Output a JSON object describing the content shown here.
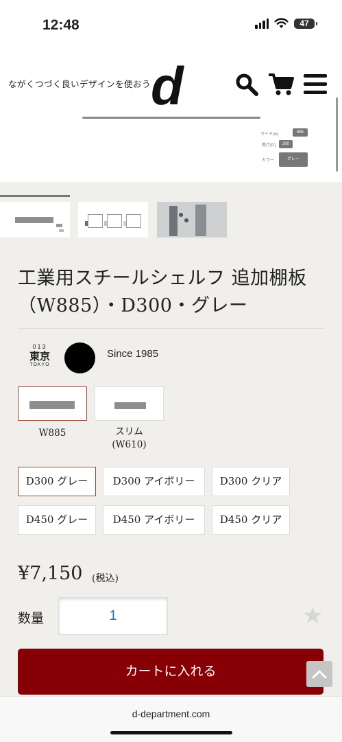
{
  "status_bar": {
    "time": "12:48",
    "battery": "47"
  },
  "header": {
    "tagline": "ながくつづく良いデザインを使おう",
    "logo": "d",
    "icons": [
      "search-icon",
      "cart-icon",
      "menu-icon"
    ],
    "options_preview": {
      "width_label": "ワイド(w)",
      "width_value": "885",
      "depth_label": "奥行(D)",
      "depth_value": "300",
      "color_label": "カラー",
      "color_value": "グレー"
    }
  },
  "product": {
    "title": "工業用スチールシェルフ 追加棚板（W885）・D300・グレー",
    "store": {
      "number": "013",
      "city": "東京",
      "city_en": "TOKYO",
      "since": "Since 1985"
    },
    "types": [
      {
        "label": "W885",
        "selected": true
      },
      {
        "label": "スリム\n(W610)",
        "selected": false
      }
    ],
    "variants": [
      {
        "label": "D300 グレー",
        "selected": true
      },
      {
        "label": "D300 アイボリー",
        "selected": false
      },
      {
        "label": "D300 クリア",
        "selected": false
      },
      {
        "label": "D450 グレー",
        "selected": false
      },
      {
        "label": "D450 アイボリー",
        "selected": false
      },
      {
        "label": "D450 クリア",
        "selected": false
      }
    ],
    "price": "¥7,150",
    "tax_note": "(税込)",
    "quantity_label": "数量",
    "quantity_value": "1",
    "add_to_cart": "カートに入れる"
  },
  "browser": {
    "url": "d-department.com"
  },
  "colors": {
    "accent": "#860006",
    "selected_border": "#a0463c",
    "qty_text": "#2b6ea6"
  }
}
